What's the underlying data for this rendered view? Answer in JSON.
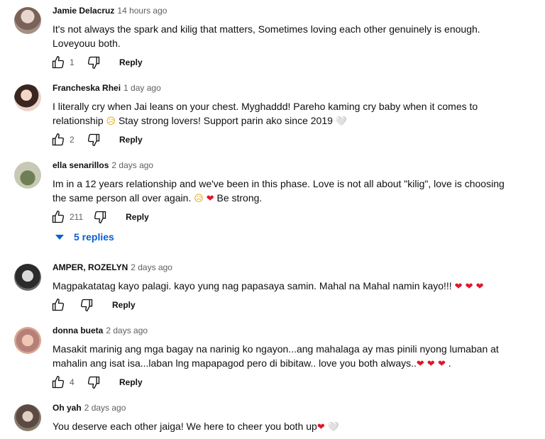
{
  "comments": [
    {
      "author": "Jamie Delacruz",
      "time": "14 hours ago",
      "text": "It's not always the spark and kilig that matters, Sometimes loving each other genuinely is enough. Loveyouu both.",
      "likes": "1",
      "reply_label": "Reply",
      "avatar_color": "#a58f86"
    },
    {
      "author": "Francheska Rhei",
      "time": "1 day ago",
      "text_before": "I literally cry when Jai leans on your chest. Myghaddd! Pareho kaming cry baby when it comes to relationship ",
      "text_after": " Stay strong lovers! Support parin ako since 2019 ",
      "emoji_1": "😥",
      "emoji_2": "🤍",
      "likes": "2",
      "reply_label": "Reply",
      "avatar_color": "#c9a08a"
    },
    {
      "author": "ella senarillos",
      "time": "2 days ago",
      "text_before": "Im in a 12 years relationship and we've been in this phase. Love is not all about \"kilig\", love is choosing the same person all over again. ",
      "emoji_1": "😥",
      "emoji_2": "❤",
      "text_after": " Be strong.",
      "likes": "211",
      "reply_label": "Reply",
      "avatar_color": "#9aa58a",
      "replies_label": "5 replies"
    },
    {
      "author": "AMPER, ROZELYN",
      "time": "2 days ago",
      "text_before": "Magpakatatag kayo palagi. kayo  yung nag papasaya samin. Mahal na Mahal namin kayo!!! ",
      "emoji_1": "❤ ❤ ❤",
      "likes": "",
      "reply_label": "Reply",
      "avatar_color": "#4a4a4a"
    },
    {
      "author": "donna bueta",
      "time": "2 days ago",
      "text_before": "Masakit marinig ang mga bagay na narinig ko ngayon...ang mahalaga ay mas pinili nyong lumaban at mahalin ang isat isa...laban lng mapapagod pero di bibitaw.. love you both always..",
      "emoji_1": "❤ ❤ ❤",
      "text_after": " .",
      "likes": "4",
      "reply_label": "Reply",
      "avatar_color": "#d8a48e"
    },
    {
      "author": "Oh yah",
      "time": "2 days ago",
      "text_before": "You deserve each other jaiga! We here to cheer you both up",
      "emoji_1": "❤",
      "emoji_2": "🤍",
      "avatar_color": "#8a7b70"
    }
  ],
  "icons": {
    "like": "thumbs-up-icon",
    "dislike": "thumbs-down-icon",
    "replies": "triangle-down-icon"
  },
  "colors": {
    "link": "#065fd4",
    "heart": "#e0162b"
  }
}
